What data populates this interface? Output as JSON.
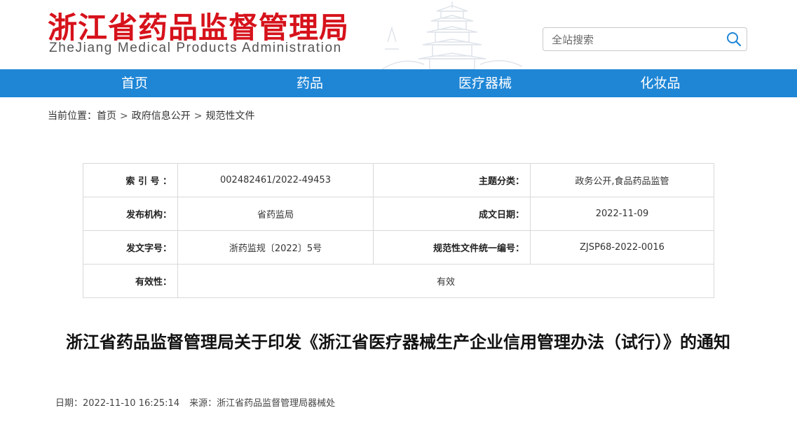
{
  "header": {
    "title": "浙江省药品监督管理局",
    "subtitle": "ZheJiang Medical Products Administration"
  },
  "search": {
    "placeholder": "全站搜索",
    "icon": "search-icon"
  },
  "nav": {
    "items": [
      "首页",
      "药品",
      "医疗器械",
      "化妆品"
    ]
  },
  "breadcrumb": {
    "prefix": "当前位置：",
    "items": [
      "首页",
      "政府信息公开",
      "规范性文件"
    ],
    "separator": ">"
  },
  "meta": {
    "index_label": "索 引 号 ：",
    "index_value": "002482461/2022-49453",
    "topic_label": "主题分类：",
    "topic_value": "政务公开,食品药品监管",
    "publisher_label": "发布机构：",
    "publisher_value": "省药监局",
    "date_label": "成文日期：",
    "date_value": "2022-11-09",
    "docno_label": "发文字号：",
    "docno_value": "浙药监规〔2022〕5号",
    "code_label": "规范性文件统一编号：",
    "code_value": "ZJSP68-2022-0016",
    "validity_label": "有效性：",
    "validity_value": "有效"
  },
  "article": {
    "title": "浙江省药品监督管理局关于印发《浙江省医疗器械生产企业信用管理办法（试行）》的通知",
    "date_label": "日期：",
    "date": "2022-11-10 16:25:14",
    "source_label": "来源：",
    "source": "浙江省药品监督管理局器械处"
  },
  "colors": {
    "brand_red": "#d6121b",
    "nav_blue": "#1f86d6"
  }
}
